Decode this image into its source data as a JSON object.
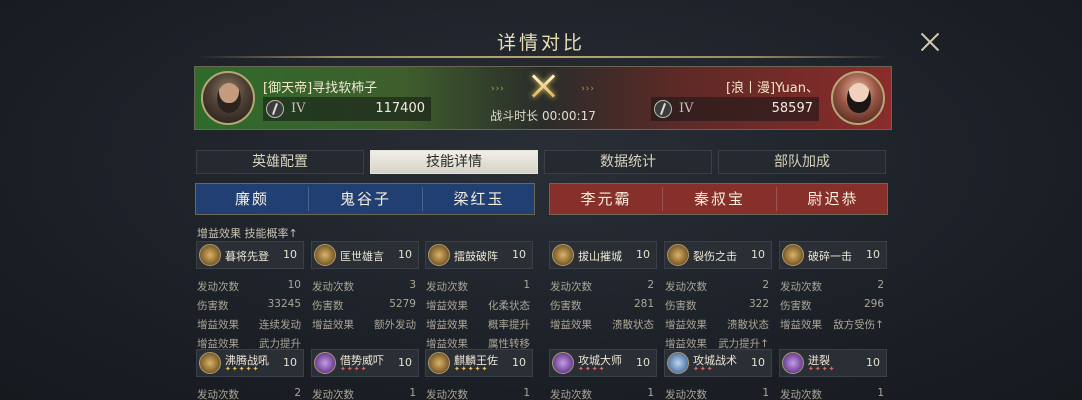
{
  "title": "详情对比",
  "battle": {
    "left": {
      "tag": "[御天帝]",
      "name": "寻找软柿子",
      "rank": "IV",
      "power": "117400"
    },
    "right": {
      "tag": "[浪丨漫]",
      "name": "Yuan、",
      "rank": "IV",
      "power": "58597"
    },
    "arrows": "›››",
    "duration": "战斗时长 00:00:17"
  },
  "tabs": [
    "英雄配置",
    "技能详情",
    "数据统计",
    "部队加成"
  ],
  "active_tab": "技能详情",
  "heroes": {
    "left": [
      "廉颇",
      "鬼谷子",
      "梁红玉"
    ],
    "right": [
      "李元霸",
      "秦叔宝",
      "尉迟恭"
    ]
  },
  "section_label": "增益效果 技能概率↑",
  "columns": [
    {
      "skill1": {
        "name": "暮将先登",
        "level": "10",
        "icon": "gold"
      },
      "stats1": [
        [
          "发动次数",
          "10"
        ],
        [
          "伤害数",
          "33245"
        ],
        [
          "增益效果",
          "连续发动"
        ],
        [
          "增益效果",
          "武力提升"
        ]
      ],
      "skill2": {
        "name": "沸腾战吼",
        "level": "10",
        "icon": "gold",
        "stars": "✦✦✦✦✦",
        "star_color": "gold"
      },
      "stats2": [
        [
          "发动次数",
          "2"
        ]
      ]
    },
    {
      "skill1": {
        "name": "匡世雄言",
        "level": "10",
        "icon": "gold"
      },
      "stats1": [
        [
          "发动次数",
          "3"
        ],
        [
          "伤害数",
          "5279"
        ],
        [
          "增益效果",
          "额外发动"
        ]
      ],
      "skill2": {
        "name": "借势威吓",
        "level": "10",
        "icon": "purple",
        "stars": "✦✦✦✦",
        "star_color": "red"
      },
      "stats2": [
        [
          "发动次数",
          "1"
        ]
      ]
    },
    {
      "skill1": {
        "name": "擂鼓破阵",
        "level": "10",
        "icon": "gold"
      },
      "stats1": [
        [
          "发动次数",
          "1"
        ],
        [
          "增益效果",
          "化柔状态"
        ],
        [
          "增益效果",
          "概率提升"
        ],
        [
          "增益效果",
          "属性转移"
        ]
      ],
      "skill2": {
        "name": "麒麟王佐",
        "level": "10",
        "icon": "gold",
        "stars": "✦✦✦✦✦",
        "star_color": "gold"
      },
      "stats2": [
        [
          "发动次数",
          "1"
        ]
      ]
    },
    {
      "skill1": {
        "name": "拔山摧城",
        "level": "10",
        "icon": "gold"
      },
      "stats1": [
        [
          "发动次数",
          "2"
        ],
        [
          "伤害数",
          "281"
        ],
        [
          "增益效果",
          "溃散状态"
        ]
      ],
      "skill2": {
        "name": "攻城大师",
        "level": "10",
        "icon": "purple",
        "stars": "✦✦✦✦",
        "star_color": "red"
      },
      "stats2": [
        [
          "发动次数",
          "1"
        ]
      ]
    },
    {
      "skill1": {
        "name": "裂伤之击",
        "level": "10",
        "icon": "gold"
      },
      "stats1": [
        [
          "发动次数",
          "2"
        ],
        [
          "伤害数",
          "322"
        ],
        [
          "增益效果",
          "溃散状态"
        ],
        [
          "增益效果",
          "武力提升↑"
        ]
      ],
      "skill2": {
        "name": "攻城战术",
        "level": "10",
        "icon": "blue",
        "stars": "✦✦✦",
        "star_color": "red"
      },
      "stats2": [
        [
          "发动次数",
          "1"
        ]
      ]
    },
    {
      "skill1": {
        "name": "破碎一击",
        "level": "10",
        "icon": "gold"
      },
      "stats1": [
        [
          "发动次数",
          "2"
        ],
        [
          "伤害数",
          "296"
        ],
        [
          "增益效果",
          "敌方受伤↑"
        ]
      ],
      "skill2": {
        "name": "迸裂",
        "level": "10",
        "icon": "purple",
        "stars": "✦✦✦✦",
        "star_color": "red"
      },
      "stats2": [
        [
          "发动次数",
          "1"
        ]
      ]
    }
  ]
}
